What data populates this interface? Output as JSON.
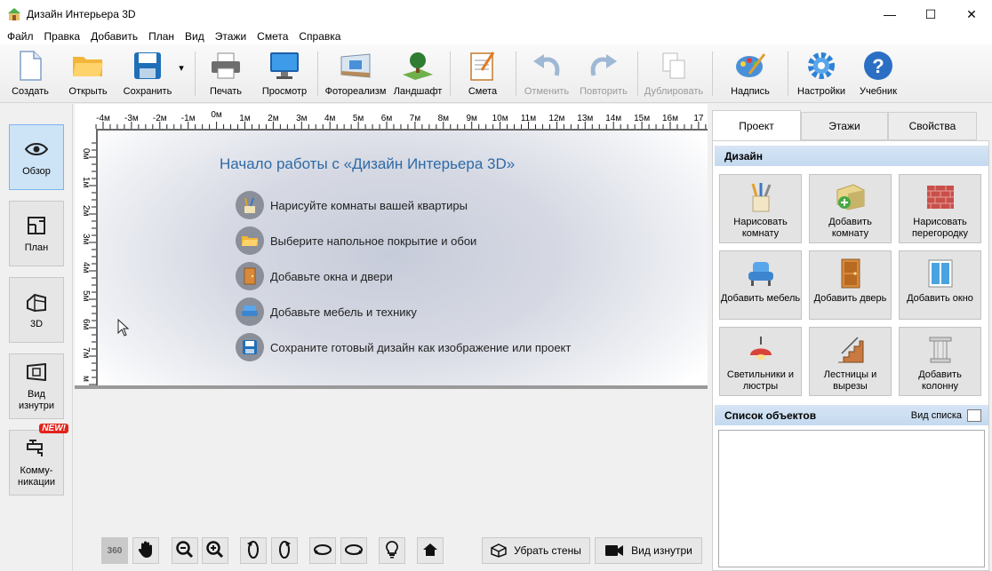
{
  "window": {
    "title": "Дизайн Интерьера 3D",
    "minimize": "—",
    "maximize": "☐",
    "close": "✕"
  },
  "menu": [
    "Файл",
    "Правка",
    "Добавить",
    "План",
    "Вид",
    "Этажи",
    "Смета",
    "Справка"
  ],
  "toolbar": {
    "create": "Создать",
    "open": "Открыть",
    "save": "Сохранить",
    "save_arrow": "▾",
    "print": "Печать",
    "preview": "Просмотр",
    "photoreal": "Фотореализм",
    "landscape": "Ландшафт",
    "estimate": "Смета",
    "undo": "Отменить",
    "redo": "Повторить",
    "duplicate": "Дублировать",
    "caption": "Надпись",
    "settings": "Настройки",
    "tutorial": "Учебник"
  },
  "left_panel": {
    "overview": "Обзор",
    "plan": "План",
    "view3d": "3D",
    "inside": "Вид изнутри",
    "comms": "Комму-никации",
    "new_badge": "NEW!"
  },
  "rulers": {
    "top": [
      "-4м",
      "-3м",
      "-2м",
      "-1м",
      "0м",
      "1м",
      "2м",
      "3м",
      "4м",
      "5м",
      "6м",
      "7м",
      "8м",
      "9м",
      "10м",
      "11м",
      "12м",
      "13м",
      "14м",
      "15м",
      "16м",
      "17"
    ],
    "left": [
      "0м",
      "1м",
      "2м",
      "3м",
      "4м",
      "5м",
      "6м",
      "7м",
      "м"
    ]
  },
  "plan": {
    "title": "Начало работы с «Дизайн Интерьера 3D»",
    "steps": [
      "Нарисуйте комнаты вашей квартиры",
      "Выберите напольное покрытие и обои",
      "Добавьте окна и двери",
      "Добавьте мебель и технику",
      "Сохраните готовый дизайн как изображение или проект"
    ]
  },
  "bottom": {
    "btn360": "360",
    "remove_walls": "Убрать стены",
    "inside_view": "Вид изнутри"
  },
  "right_panel": {
    "tabs": [
      "Проект",
      "Этажи",
      "Свойства"
    ],
    "design_header": "Дизайн",
    "design_buttons": [
      "Нарисовать комнату",
      "Добавить комнату",
      "Нарисовать перегородку",
      "Добавить мебель",
      "Добавить дверь",
      "Добавить окно",
      "Светильники и люстры",
      "Лестницы и вырезы",
      "Добавить колонну"
    ],
    "objects_header": "Список объектов",
    "list_view": "Вид списка"
  },
  "colors": {
    "accent_title": "#2e6aa6",
    "active_tab": "#cde4f7",
    "section_header": "#c4d9ef",
    "badge": "#e2231a"
  }
}
